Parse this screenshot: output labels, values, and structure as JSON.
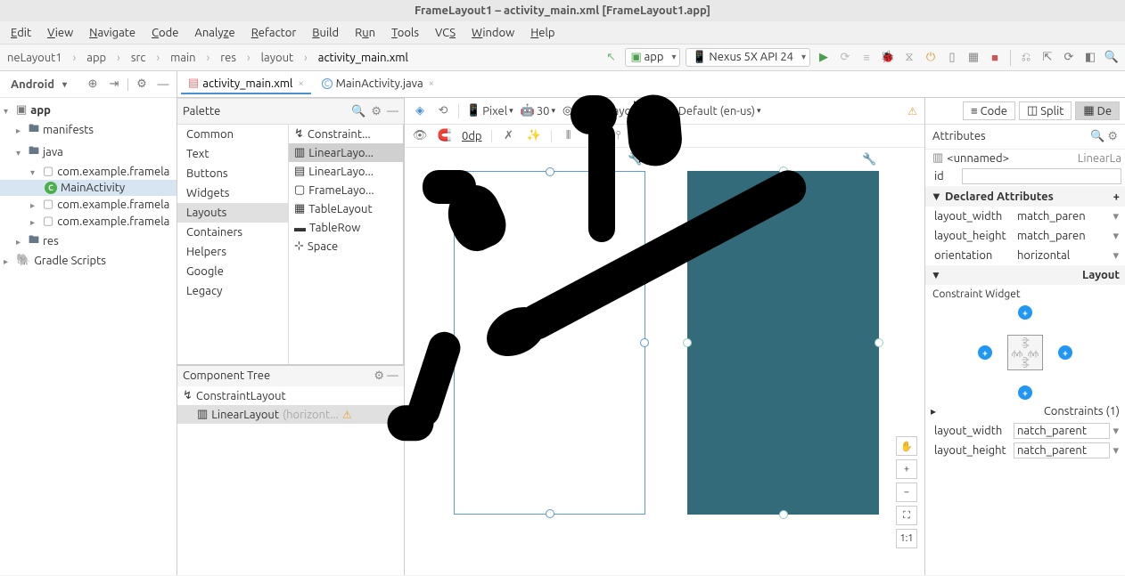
{
  "window": {
    "title": "FrameLayout1 – activity_main.xml [FrameLayout1.app]"
  },
  "menu": [
    "Edit",
    "View",
    "Navigate",
    "Code",
    "Analyze",
    "Refactor",
    "Build",
    "Run",
    "Tools",
    "VCS",
    "Window",
    "Help"
  ],
  "breadcrumbs": [
    "neLayout1",
    "app",
    "src",
    "main",
    "res",
    "layout",
    "activity_main.xml"
  ],
  "run_config": {
    "app": "app",
    "device": "Nexus 5X API 24"
  },
  "project_view": {
    "mode": "Android",
    "tree": [
      {
        "label": "app",
        "icon": "module",
        "depth": 0,
        "open": true
      },
      {
        "label": "manifests",
        "icon": "folder",
        "depth": 1,
        "open": false
      },
      {
        "label": "java",
        "icon": "folder",
        "depth": 1,
        "open": true
      },
      {
        "label": "com.example.framela",
        "icon": "package",
        "depth": 2,
        "open": true
      },
      {
        "label": "MainActivity",
        "icon": "class",
        "depth": 3,
        "open": false,
        "selected": true
      },
      {
        "label": "com.example.framela",
        "icon": "package",
        "depth": 2,
        "open": false
      },
      {
        "label": "com.example.framela",
        "icon": "package",
        "depth": 2,
        "open": false
      },
      {
        "label": "res",
        "icon": "folder",
        "depth": 1,
        "open": false
      },
      {
        "label": "Gradle Scripts",
        "icon": "gradle",
        "depth": 0,
        "open": false
      }
    ]
  },
  "editor_tabs": [
    {
      "label": "activity_main.xml",
      "icon": "xml",
      "active": true
    },
    {
      "label": "MainActivity.java",
      "icon": "java",
      "active": false
    }
  ],
  "palette": {
    "title": "Palette",
    "categories": [
      "Common",
      "Text",
      "Buttons",
      "Widgets",
      "Layouts",
      "Containers",
      "Helpers",
      "Google",
      "Legacy"
    ],
    "selected_category": "Layouts",
    "items": [
      "Constraint...",
      "LinearLayo...",
      "LinearLayo...",
      "FrameLayo...",
      "TableLayout",
      "TableRow",
      "Space"
    ],
    "selected_item": "LinearLayo..."
  },
  "design_toolbar": {
    "device": "Pixel",
    "api": "30",
    "theme": "FrameLayout1",
    "locale": "Default (en-us)",
    "margin": "0dp"
  },
  "component_tree": {
    "title": "Component Tree",
    "items": [
      {
        "label": "ConstraintLayout",
        "depth": 0
      },
      {
        "label": "LinearLayout",
        "hint": "(horizont...",
        "depth": 1,
        "warn": true,
        "selected": true
      }
    ]
  },
  "attributes": {
    "title": "Attributes",
    "view_modes": [
      "Code",
      "Split",
      "De"
    ],
    "active_mode": "De",
    "selected": "<unnamed>",
    "selected_type": "LinearLa",
    "id": "",
    "declared": [
      {
        "label": "layout_width",
        "value": "match_paren"
      },
      {
        "label": "layout_height",
        "value": "match_paren"
      },
      {
        "label": "orientation",
        "value": "horizontal"
      }
    ],
    "layout_section": "Layout",
    "constraint_label": "Constraint Widget",
    "constraints_section": "Constraints (1)",
    "constraints": [
      {
        "label": "layout_width",
        "value": "natch_parent"
      },
      {
        "label": "layout_height",
        "value": "natch_parent"
      }
    ]
  },
  "zoom": {
    "ratio": "1:1"
  }
}
